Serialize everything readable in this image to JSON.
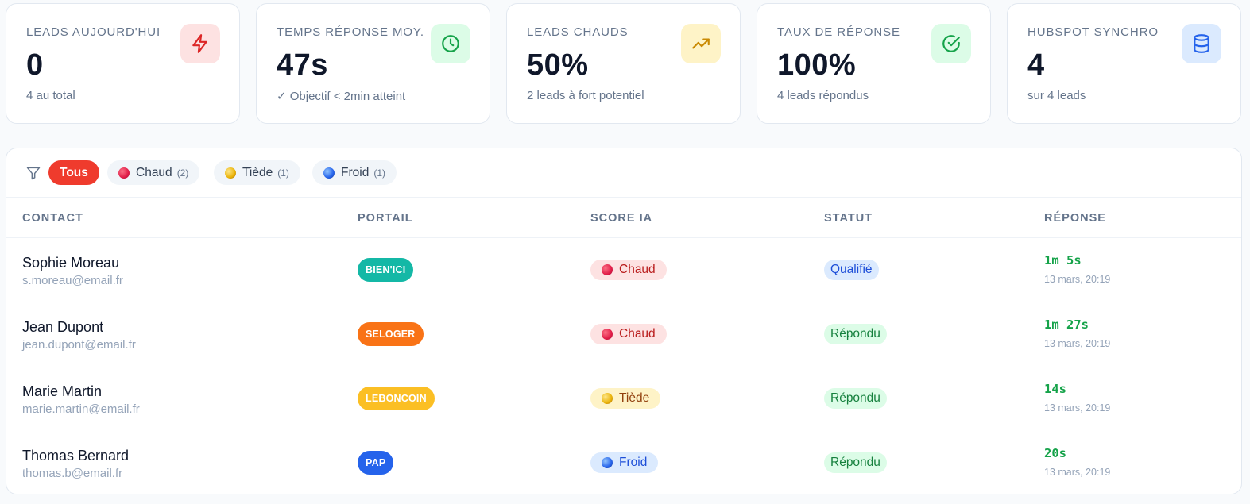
{
  "cards": [
    {
      "label": "LEADS AUJOURD'HUI",
      "value": "0",
      "sub": "4 au total",
      "icon": "lightning-icon",
      "color": "#dc2626",
      "bg": "#fde2e2"
    },
    {
      "label": "TEMPS RÉPONSE MOY.",
      "value": "47s",
      "sub": "✓ Objectif < 2min atteint",
      "icon": "clock-icon",
      "color": "#16a34a",
      "bg": "#dcfce7"
    },
    {
      "label": "LEADS CHAUDS",
      "value": "50%",
      "sub": "2 leads à fort potentiel",
      "icon": "trending-up-icon",
      "color": "#ca8a04",
      "bg": "#fef3c7"
    },
    {
      "label": "TAUX DE RÉPONSE",
      "value": "100%",
      "sub": "4 leads répondus",
      "icon": "check-circle-icon",
      "color": "#16a34a",
      "bg": "#dcfce7"
    },
    {
      "label": "HUBSPOT SYNCHRO",
      "value": "4",
      "sub": "sur 4 leads",
      "icon": "database-icon",
      "color": "#2563eb",
      "bg": "#dbeafe"
    }
  ],
  "filters": {
    "icon": "filter-icon",
    "chips": [
      {
        "label": "Tous",
        "count": "",
        "active": true
      },
      {
        "label": "Chaud",
        "count": "(2)",
        "dot": "#e11d48"
      },
      {
        "label": "Tiède",
        "count": "(1)",
        "dot": "#eab308"
      },
      {
        "label": "Froid",
        "count": "(1)",
        "dot": "#2563eb"
      }
    ]
  },
  "table": {
    "headers": [
      "CONTACT",
      "PORTAIL",
      "SCORE IA",
      "STATUT",
      "RÉPONSE"
    ],
    "rows": [
      {
        "name": "Sophie Moreau",
        "email": "s.moreau@email.fr",
        "portal": "BIEN'ICI",
        "portal_color": "#14b8a6",
        "score": "Chaud",
        "score_type": "hot",
        "status": "Qualifié",
        "status_type": "qualified",
        "response": "1m 5s",
        "date": "13 mars, 20:19"
      },
      {
        "name": "Jean Dupont",
        "email": "jean.dupont@email.fr",
        "portal": "SELOGER",
        "portal_color": "#f97316",
        "score": "Chaud",
        "score_type": "hot",
        "status": "Répondu",
        "status_type": "answered",
        "response": "1m 27s",
        "date": "13 mars, 20:19"
      },
      {
        "name": "Marie Martin",
        "email": "marie.martin@email.fr",
        "portal": "LEBONCOIN",
        "portal_color": "#fbbf24",
        "score": "Tiède",
        "score_type": "warm",
        "status": "Répondu",
        "status_type": "answered",
        "response": "14s",
        "date": "13 mars, 20:19"
      },
      {
        "name": "Thomas Bernard",
        "email": "thomas.b@email.fr",
        "portal": "PAP",
        "portal_color": "#2563eb",
        "score": "Froid",
        "score_type": "cold",
        "status": "Répondu",
        "status_type": "answered",
        "response": "20s",
        "date": "13 mars, 20:19"
      }
    ]
  }
}
